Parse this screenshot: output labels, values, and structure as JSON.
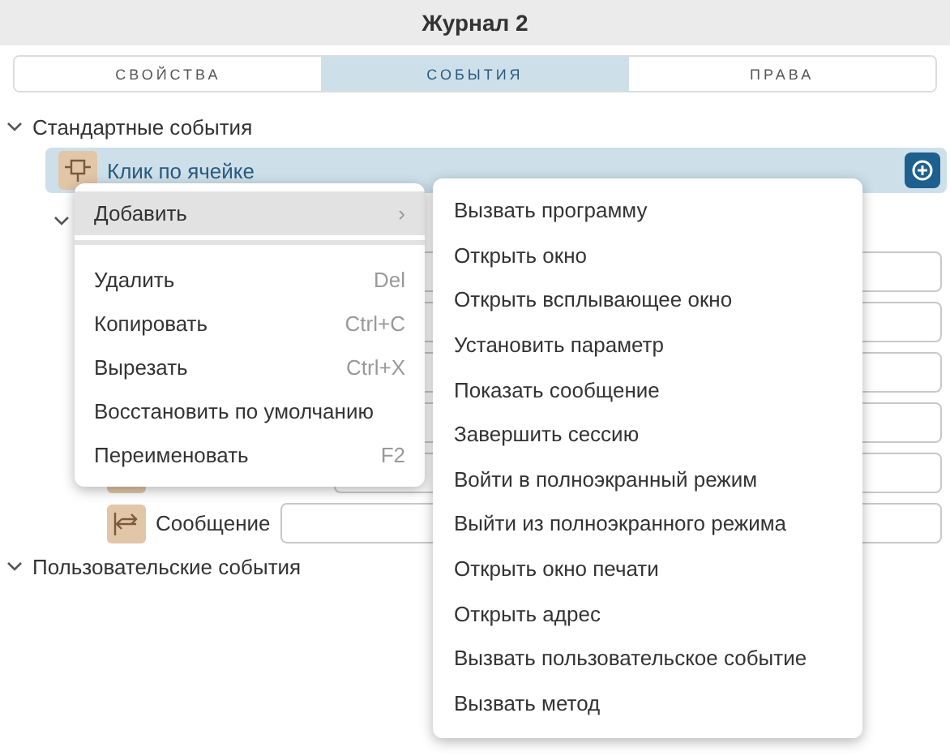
{
  "window": {
    "title": "Журнал 2"
  },
  "tabs": [
    {
      "label": "СВОЙСТВА",
      "selected": false
    },
    {
      "label": "СОБЫТИЯ",
      "selected": true
    },
    {
      "label": "ПРАВА",
      "selected": false
    }
  ],
  "tree": [
    {
      "label": "Стандартные события",
      "expanded": true,
      "children": [
        {
          "label": "Клик по ячейке",
          "selected": true,
          "expanded": true,
          "params": [
            {
              "kind": "field"
            },
            {
              "kind": "field"
            },
            {
              "kind": "field"
            },
            {
              "kind": "field"
            },
            {
              "kind": "icon_field"
            },
            {
              "kind": "param",
              "label": "Сообщение"
            }
          ]
        }
      ]
    },
    {
      "label": "Пользовательские события",
      "expanded": true
    }
  ],
  "context_menu": {
    "items": [
      {
        "label": "Добавить",
        "shortcut": "›",
        "kind": "submenu",
        "selected": true
      },
      {
        "kind": "separator"
      },
      {
        "label": "Удалить",
        "shortcut": "Del",
        "kind": "item",
        "selected": false
      },
      {
        "label": "Копировать",
        "shortcut": "Ctrl+C",
        "kind": "item",
        "selected": false
      },
      {
        "label": "Вырезать",
        "shortcut": "Ctrl+X",
        "kind": "item",
        "selected": false
      },
      {
        "label": "Восстановить по умолчанию",
        "kind": "item",
        "selected": false
      },
      {
        "label": "Переименовать",
        "shortcut": "F2",
        "kind": "item",
        "selected": false
      }
    ]
  },
  "submenu": {
    "items": [
      "Вызвать программу",
      "Открыть окно",
      "Открыть всплывающее окно",
      "Установить параметр",
      "Показать сообщение",
      "Завершить сессию",
      "Войти в полноэкранный режим",
      "Выйти из полноэкранного режима",
      "Открыть окно печати",
      "Открыть адрес",
      "Вызвать пользовательское событие",
      "Вызвать метод"
    ]
  }
}
